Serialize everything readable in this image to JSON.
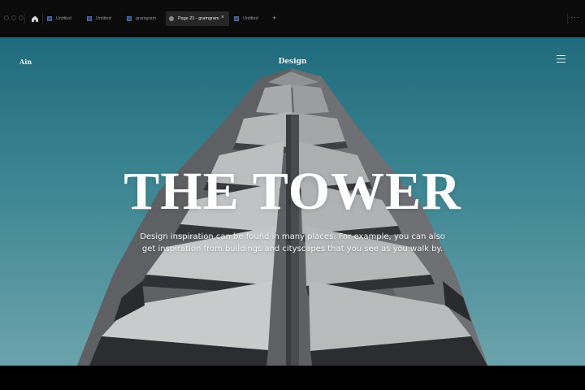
{
  "browser": {
    "tabs": [
      {
        "label": "Untitled",
        "active": false
      },
      {
        "label": "Untitled",
        "active": false
      },
      {
        "label": "gramgram",
        "active": false
      },
      {
        "label": "Page 21 - gramgram",
        "active": true
      },
      {
        "label": "Untitled",
        "active": false
      }
    ],
    "new_tab_label": "+",
    "close_glyph": "×",
    "more_glyph": "···",
    "icons": [
      "home-icon",
      "close-icon",
      "plus-icon",
      "more-icon"
    ]
  },
  "site": {
    "brand": "Ain",
    "nav_title": "Design",
    "menu_icon": "hamburger-menu-icon"
  },
  "hero": {
    "title": "THE TOWER",
    "text": "Design inspiration can be found in many places. For example, you can also get inspiration from buildings and cityscapes that you see as you walk by."
  },
  "colors": {
    "sky_top": "#1f6a7c",
    "sky_bottom": "#6ba3ab",
    "chrome_bg": "#0b0b0b",
    "active_tab": "#262626"
  }
}
